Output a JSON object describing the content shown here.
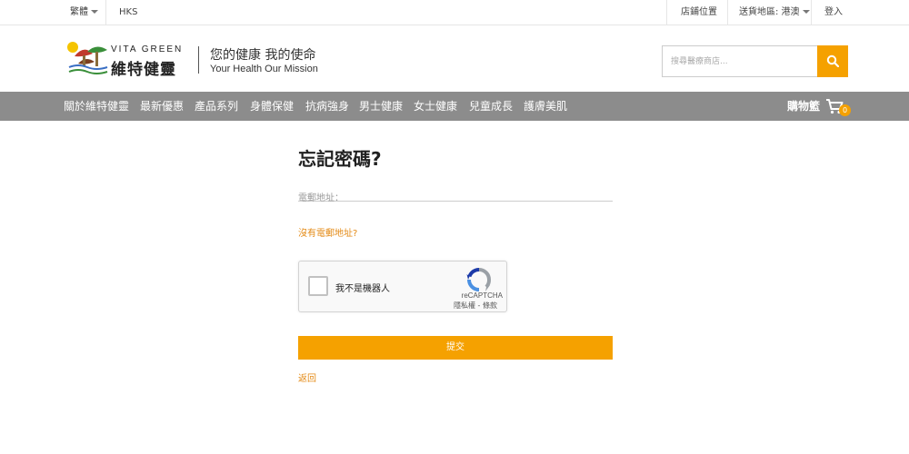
{
  "topbar": {
    "language": "繁體",
    "currency": "HKS",
    "store_locations": "店鋪位置",
    "delivery_region": "送貨地區: 港澳",
    "login": "登入"
  },
  "header": {
    "logo_en": "VITA GREEN",
    "logo_zh": "維特健靈",
    "slogan_zh": "您的健康 我的使命",
    "slogan_en": "Your Health Our Mission",
    "search_placeholder": "搜尋醫療商店..."
  },
  "nav": {
    "items": [
      {
        "label": "關於維特健靈"
      },
      {
        "label": "最新優惠"
      },
      {
        "label": "產品系列"
      },
      {
        "label": "身體保健"
      },
      {
        "label": "抗病強身"
      },
      {
        "label": "男士健康"
      },
      {
        "label": "女士健康"
      },
      {
        "label": "兒童成長"
      },
      {
        "label": "護膚美肌"
      }
    ],
    "cart_label": "購物籃",
    "cart_count": "0"
  },
  "form": {
    "title": "忘記密碼?",
    "email_placeholder": "電郵地址：",
    "no_email_link": "沒有電郵地址?",
    "submit_label": "提交",
    "back_link": "返回"
  },
  "recaptcha": {
    "label": "我不是機器人",
    "brand": "reCAPTCHA",
    "terms": "隱私權 - 條款"
  },
  "colors": {
    "accent": "#f5a100",
    "link": "#e48b17",
    "nav_bg": "#8c8c8c"
  }
}
